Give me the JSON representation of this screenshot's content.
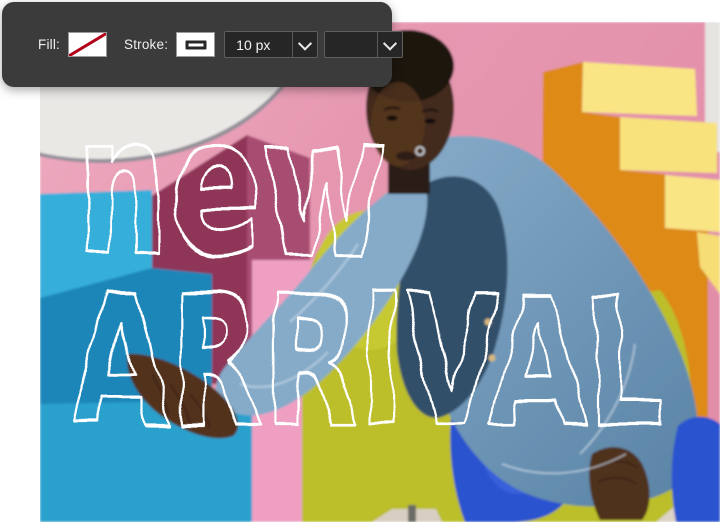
{
  "toolbar": {
    "background_color": "#3b3b3b",
    "fill": {
      "label": "Fill:",
      "value": "none",
      "swatch_style": "white-with-red-slash"
    },
    "stroke": {
      "label": "Stroke:",
      "color": "black",
      "width_value": "10 px",
      "style": "solid-line"
    }
  },
  "canvas": {
    "overlay_text": {
      "line1": "new",
      "line2": "ARRIVAL",
      "color": "#ffffff",
      "style": "hollow-outline-display-lettering"
    },
    "photo_colors": {
      "wall_pink": "#e697b0",
      "arch_white": "#eae8e5",
      "wall_crimson_dark": "#8f3458",
      "wall_crimson_light": "#a84e72",
      "steps_cyan_top": "#35aeda",
      "steps_cyan_mid": "#1f86b8",
      "steps_cyan_front": "#2ba0cd",
      "pedestal_pink": "#efa0c2",
      "chair_chartreuse": "#bcbe2c",
      "stairs_orange": "#dd8a12",
      "stairs_yellow": "#f9e584",
      "pillar_white": "#e6e3e0",
      "denim_jacket": "#7ba2c2",
      "denim_dark": "#33506b",
      "boots_blue": "#2a52cf",
      "skin": "#54321f",
      "floor_tile": "#ddd3c6"
    }
  }
}
